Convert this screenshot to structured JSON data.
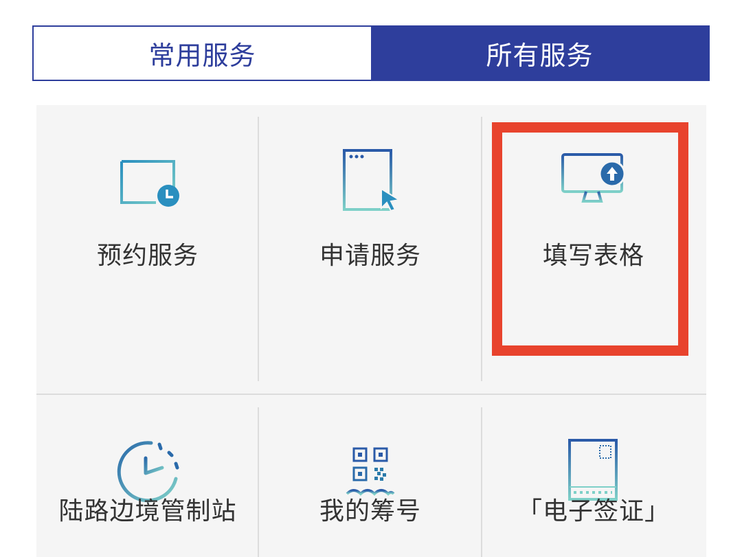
{
  "tabs": {
    "common": "常用服务",
    "all": "所有服务"
  },
  "services": [
    {
      "label": "预约服务",
      "icon": "calendar-clock-icon"
    },
    {
      "label": "申请服务",
      "icon": "browser-cursor-icon"
    },
    {
      "label": "填写表格",
      "icon": "monitor-upload-icon"
    },
    {
      "label": "陆路边境管制站",
      "icon": "clock-dial-icon"
    },
    {
      "label": "我的筹号",
      "icon": "queue-ticket-icon"
    },
    {
      "label": "「电子签证」",
      "icon": "e-visa-icon"
    }
  ],
  "colors": {
    "brand": "#2e3e9c",
    "highlight": "#e8432d",
    "icon_gradient_start": "#2a8fbf",
    "icon_gradient_end": "#7ed0c8"
  }
}
